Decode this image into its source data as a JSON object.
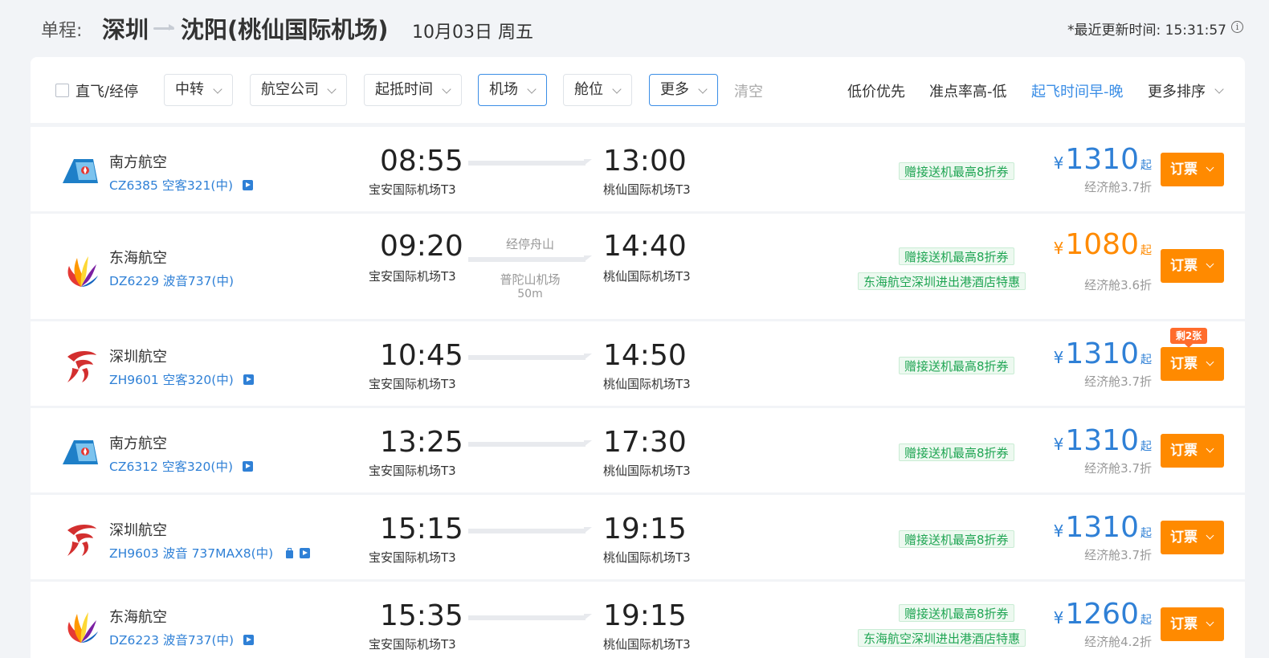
{
  "header": {
    "trip_type": "单程:",
    "from_city": "深圳",
    "to_city": "沈阳(桃仙国际机场)",
    "date": "10月03日 周五",
    "update_time": "*最近更新时间: 15:31:57",
    "info_icon": "info-icon"
  },
  "filters": {
    "direct_label": "直飞/经停",
    "transfer": "中转",
    "airline": "航空公司",
    "time": "起抵时间",
    "airport": "机场",
    "cabin": "舱位",
    "more": "更多",
    "clear": "清空"
  },
  "sorts": {
    "low_price": "低价优先",
    "on_time": "准点率高-低",
    "depart_time": "起飞时间早-晚",
    "more_sort": "更多排序"
  },
  "colors": {
    "accent_blue": "#2f80d6",
    "orange": "#ff8a00",
    "tag_green": "#1fa553"
  },
  "flights": [
    {
      "airline": "南方航空",
      "flight": "CZ6385 空客321(中)",
      "logo": "china-southern-logo",
      "dep_time": "08:55",
      "dep_airport": "宝安国际机场T3",
      "arr_time": "13:00",
      "arr_airport": "桃仙国际机场T3",
      "tags": [
        "赠接送机最高8折券"
      ],
      "price": "1310",
      "price_suffix": "起",
      "cabin": "经济舱3.7折",
      "book": "订票"
    },
    {
      "airline": "东海航空",
      "flight": "DZ6229 波音737(中)",
      "logo": "donghai-logo",
      "dep_time": "09:20",
      "dep_airport": "宝安国际机场T3",
      "arr_time": "14:40",
      "arr_airport": "桃仙国际机场T3",
      "stop": "经停舟山",
      "stop_airport": "普陀山机场",
      "stop_duration": "50m",
      "tags": [
        "赠接送机最高8折券",
        "东海航空深圳进出港酒店特惠"
      ],
      "price": "1080",
      "price_suffix": "起",
      "cabin": "经济舱3.6折",
      "book": "订票"
    },
    {
      "airline": "深圳航空",
      "flight": "ZH9601 空客320(中)",
      "logo": "shenzhen-airlines-logo",
      "dep_time": "10:45",
      "dep_airport": "宝安国际机场T3",
      "arr_time": "14:50",
      "arr_airport": "桃仙国际机场T3",
      "tags": [
        "赠接送机最高8折券"
      ],
      "price": "1310",
      "price_suffix": "起",
      "cabin": "经济舱3.7折",
      "book": "订票",
      "remaining": "剩2张"
    },
    {
      "airline": "南方航空",
      "flight": "CZ6312 空客320(中)",
      "logo": "china-southern-logo",
      "dep_time": "13:25",
      "dep_airport": "宝安国际机场T3",
      "arr_time": "17:30",
      "arr_airport": "桃仙国际机场T3",
      "tags": [
        "赠接送机最高8折券"
      ],
      "price": "1310",
      "price_suffix": "起",
      "cabin": "经济舱3.7折",
      "book": "订票"
    },
    {
      "airline": "深圳航空",
      "flight": "ZH9603 波音 737MAX8(中)",
      "logo": "shenzhen-airlines-logo",
      "dep_time": "15:15",
      "dep_airport": "宝安国际机场T3",
      "arr_time": "19:15",
      "arr_airport": "桃仙国际机场T3",
      "tags": [
        "赠接送机最高8折券"
      ],
      "price": "1310",
      "price_suffix": "起",
      "cabin": "经济舱3.7折",
      "book": "订票"
    },
    {
      "airline": "东海航空",
      "flight": "DZ6223 波音737(中)",
      "logo": "donghai-logo",
      "dep_time": "15:35",
      "dep_airport": "宝安国际机场T3",
      "arr_time": "19:15",
      "arr_airport": "桃仙国际机场T3",
      "tags": [
        "赠接送机最高8折券",
        "东海航空深圳进出港酒店特惠"
      ],
      "price": "1260",
      "price_suffix": "起",
      "cabin": "经济舱4.2折",
      "book": "订票"
    }
  ]
}
